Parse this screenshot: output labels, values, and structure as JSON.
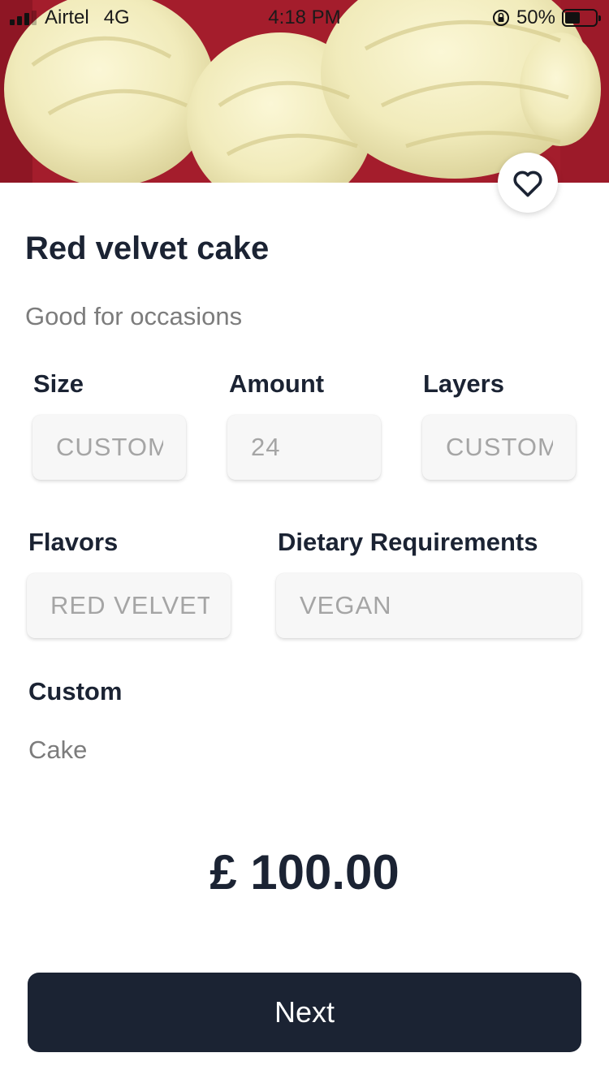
{
  "status_bar": {
    "carrier": "Airtel",
    "network": "4G",
    "time": "4:18 PM",
    "battery": "50%",
    "battery_level": 0.5
  },
  "product": {
    "title": "Red velvet cake",
    "subtitle": "Good for occasions"
  },
  "options": {
    "size": {
      "label": "Size",
      "value": "CUSTOM"
    },
    "amount": {
      "label": "Amount",
      "value": "24"
    },
    "layers": {
      "label": "Layers",
      "value": "CUSTOM"
    },
    "flavors": {
      "label": "Flavors",
      "value": "RED VELVET"
    },
    "dietary": {
      "label": "Dietary Requirements",
      "value": "VEGAN"
    },
    "custom": {
      "label": "Custom",
      "value": "Cake"
    }
  },
  "price": "£ 100.00",
  "next_label": "Next",
  "icons": {
    "favorite": "heart-outline-icon",
    "orientation_lock": "orientation-lock-icon"
  },
  "colors": {
    "primary_dark": "#1b2333",
    "muted_text": "#7c7c7c",
    "field_placeholder": "#a5a5a5",
    "field_background": "#f7f7f7"
  }
}
